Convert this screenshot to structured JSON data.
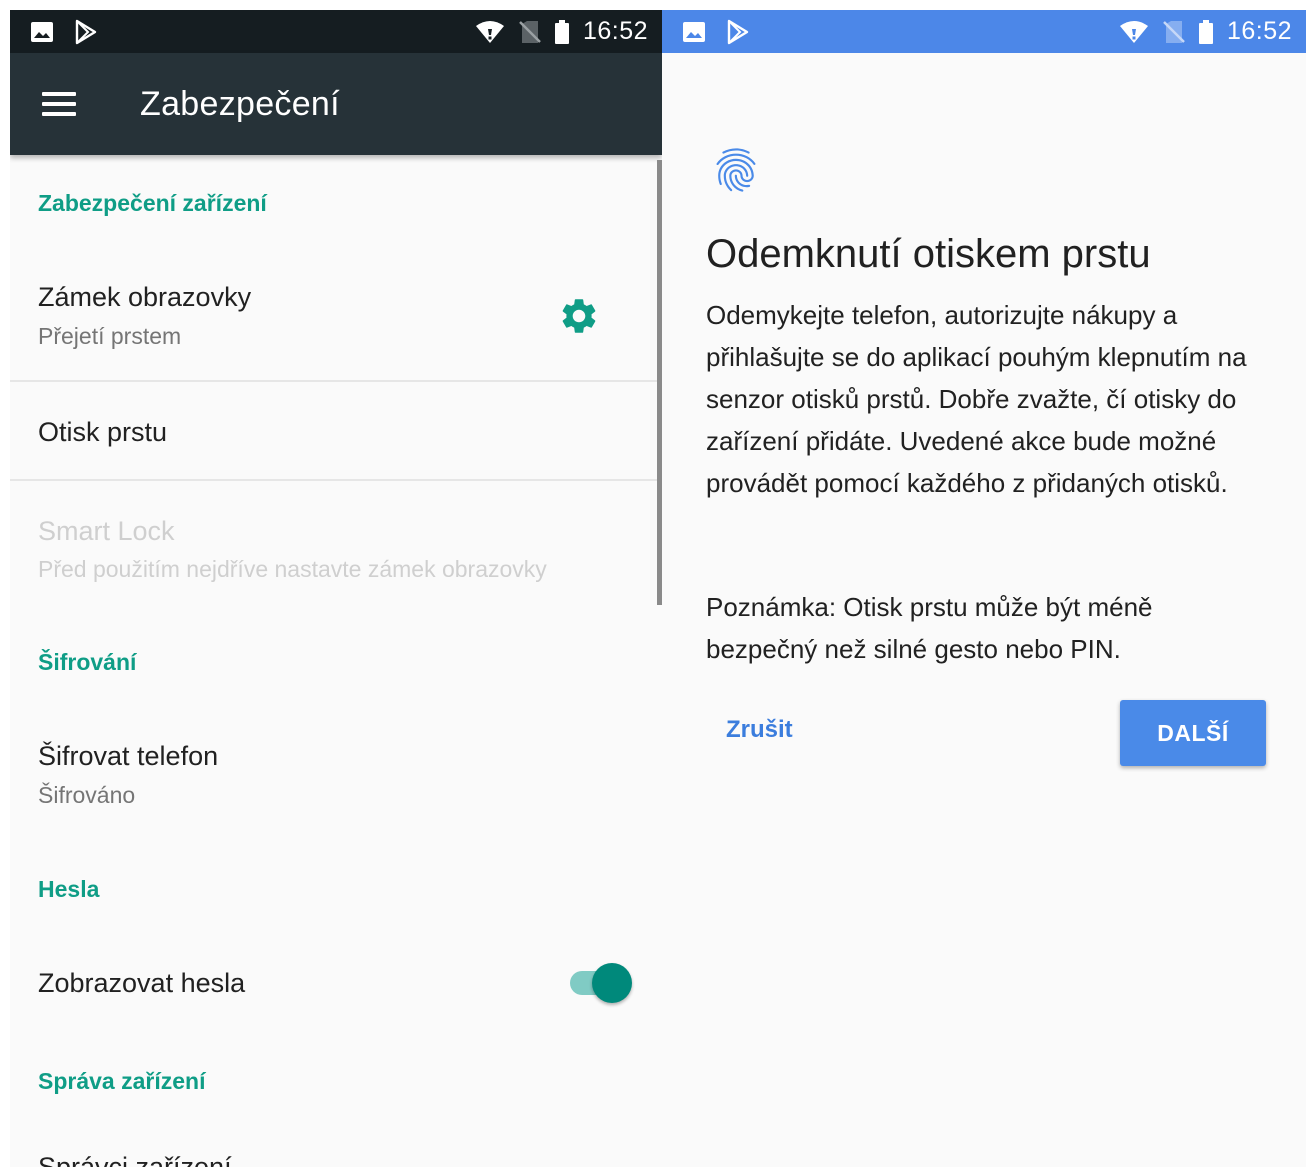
{
  "left": {
    "status_bar": {
      "time": "16:52",
      "left_icons": [
        "image-icon",
        "play-store-icon"
      ],
      "right_icons": [
        "wifi-icon",
        "no-sim-icon",
        "battery-icon"
      ]
    },
    "toolbar": {
      "menu_icon": "hamburger-menu-icon",
      "title": "Zabezpečení"
    },
    "sections": {
      "device_security": {
        "header": "Zabezpečení zařízení",
        "screen_lock": {
          "title": "Zámek obrazovky",
          "subtitle": "Přejetí prstem",
          "action_icon": "gear-icon"
        },
        "fingerprint": {
          "title": "Otisk prstu"
        },
        "smart_lock": {
          "title": "Smart Lock",
          "subtitle": "Před použitím nejdříve nastavte zámek obrazovky",
          "enabled": false
        }
      },
      "encryption": {
        "header": "Šifrování",
        "encrypt_phone": {
          "title": "Šifrovat telefon",
          "subtitle": "Šifrováno"
        }
      },
      "passwords": {
        "header": "Hesla",
        "show_passwords": {
          "title": "Zobrazovat hesla",
          "toggle_on": true
        }
      },
      "device_admin": {
        "header": "Správa zařízení",
        "partial_item": "Správci zařízení"
      }
    }
  },
  "right": {
    "status_bar": {
      "time": "16:52",
      "left_icons": [
        "image-icon",
        "play-store-icon"
      ],
      "right_icons": [
        "wifi-icon",
        "no-sim-icon",
        "battery-icon"
      ]
    },
    "icon": "fingerprint-icon",
    "title": "Odemknutí otiskem prstu",
    "body": "Odemykejte telefon, autorizujte nákupy a přihlašujte se do aplikací pouhým klepnutím na senzor otisků prstů. Dobře zvažte, čí otisky do zařízení přidáte. Uvedené akce bude možné provádět pomocí každého z přidaných otisků.",
    "note": "Poznámka: Otisk prstu může být méně bezpečný než silné gesto nebo PIN.",
    "cancel_label": "Zrušit",
    "next_label": "DALŠÍ"
  },
  "colors": {
    "accent_teal": "#0f9d86",
    "toolbar_dark": "#263238",
    "status_dark": "#151d21",
    "status_blue": "#4c87e8",
    "button_blue": "#4a8ae8",
    "link_blue": "#3b7ddd"
  }
}
